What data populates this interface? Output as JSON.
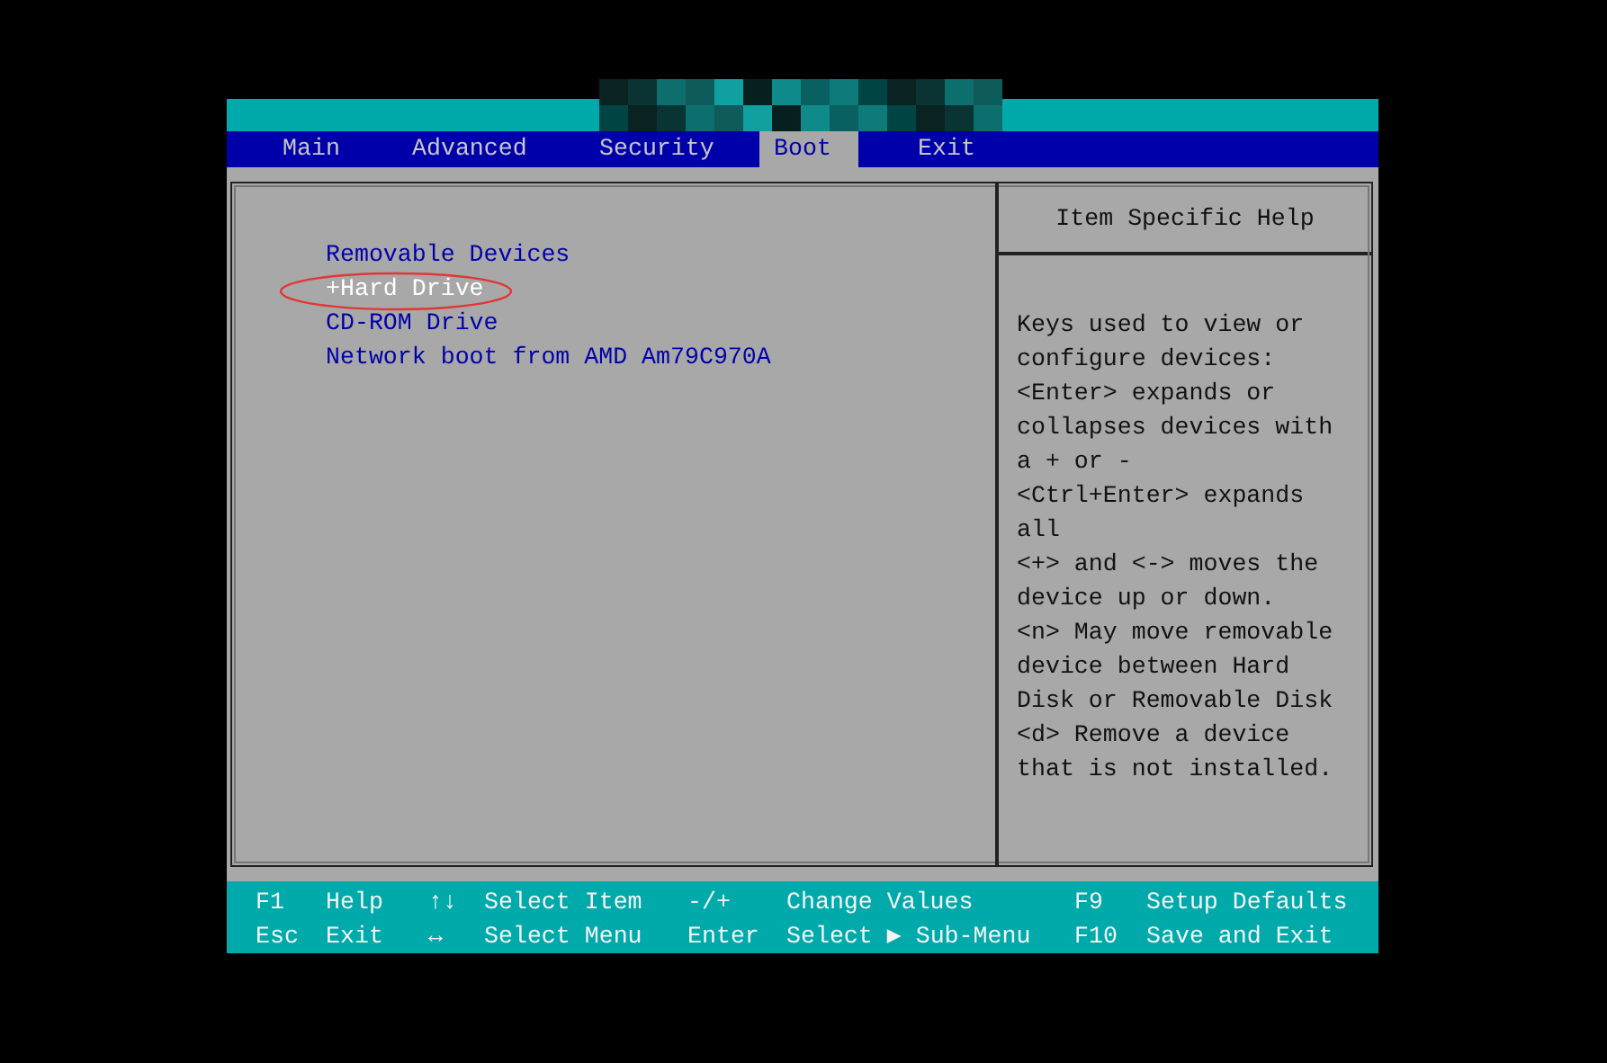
{
  "menu_bar": {
    "tabs": [
      {
        "label": "Main",
        "selected": false
      },
      {
        "label": "Advanced",
        "selected": false
      },
      {
        "label": "Security",
        "selected": false
      },
      {
        "label": "Boot",
        "selected": true
      },
      {
        "label": "Exit",
        "selected": false
      }
    ]
  },
  "boot_order": {
    "items": [
      {
        "label": "Removable Devices",
        "selected": false
      },
      {
        "label": "+Hard Drive",
        "selected": true
      },
      {
        "label": "CD-ROM Drive",
        "selected": false
      },
      {
        "label": "Network boot from AMD Am79C970A",
        "selected": false
      }
    ]
  },
  "help_panel": {
    "title": "Item Specific Help",
    "text": "Keys used to view or\nconfigure devices:\n<Enter> expands or\ncollapses devices with\na + or -\n<Ctrl+Enter> expands\nall\n<+> and <-> moves the\ndevice up or down.\n<n> May move removable\ndevice between Hard\nDisk or Removable Disk\n<d> Remove a device\nthat is not installed."
  },
  "footer": {
    "rows": [
      [
        {
          "key": "F1",
          "action": "Help"
        },
        {
          "key": "↑↓",
          "action": "Select Item"
        },
        {
          "key": "-/+",
          "action": "Change Values"
        },
        {
          "key": "F9",
          "action": "Setup Defaults"
        }
      ],
      [
        {
          "key": "Esc",
          "action": "Exit"
        },
        {
          "key": "↔",
          "action": "Select Menu"
        },
        {
          "key": "Enter",
          "action": "Select ▶ Sub-Menu"
        },
        {
          "key": "F10",
          "action": "Save and Exit"
        }
      ]
    ]
  }
}
